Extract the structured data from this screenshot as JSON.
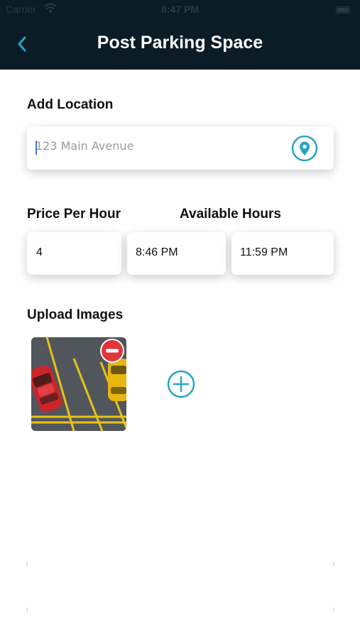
{
  "status_bar": {
    "carrier": "Carrier",
    "time": "8:47 PM"
  },
  "header": {
    "title": "Post Parking Space",
    "back_icon": "chevron-left-icon"
  },
  "location": {
    "label": "Add Location",
    "placeholder": "123 Main Avenue",
    "value": "",
    "icon": "map-pin-icon"
  },
  "pricing": {
    "price_label": "Price Per Hour",
    "price_value": "4",
    "hours_label": "Available Hours",
    "start_time": "8:46 PM",
    "end_time": "11:59 PM"
  },
  "images": {
    "label": "Upload Images",
    "remove_icon": "minus-circle-icon",
    "add_icon": "plus-circle-icon"
  },
  "colors": {
    "header_bg": "#0b1c26",
    "accent": "#2aa3c4",
    "remove_red": "#e0353a",
    "title_text": "#ffffff"
  }
}
